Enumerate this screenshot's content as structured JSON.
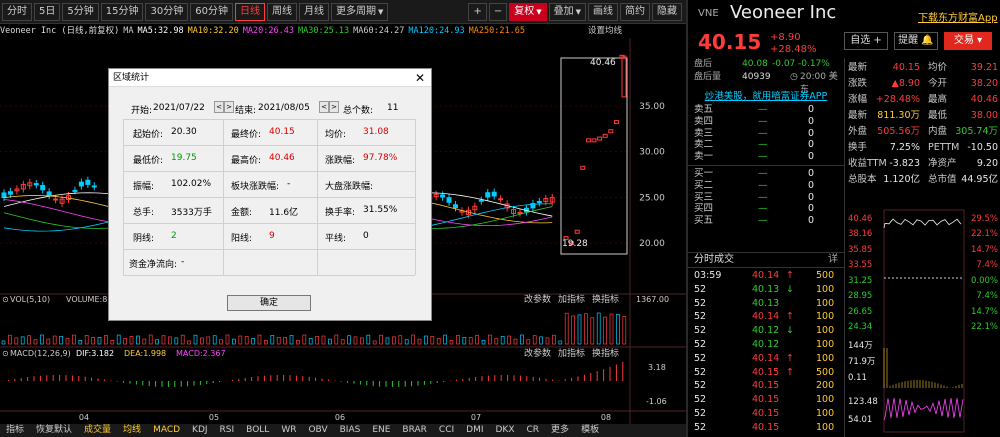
{
  "toolbar": {
    "periods": [
      "分时",
      "5日",
      "5分钟",
      "15分钟",
      "30分钟",
      "60分钟",
      "日线",
      "周线",
      "月线",
      "更多周期"
    ],
    "active": "日线",
    "right": [
      "复权",
      "叠加",
      "画线",
      "简约",
      "隐藏"
    ]
  },
  "ma_bar": {
    "name": "Veoneer Inc (日线,前复权)",
    "items": [
      {
        "k": "MA",
        "v": "",
        "c": "#cccccc"
      },
      {
        "k": "MA5:",
        "v": "32.98",
        "c": "#ffffff"
      },
      {
        "k": "MA10:",
        "v": "32.20",
        "c": "#ffcc33"
      },
      {
        "k": "MA20:",
        "v": "26.43",
        "c": "#ff44ff"
      },
      {
        "k": "MA30:",
        "v": "25.13",
        "c": "#2ccc2c"
      },
      {
        "k": "MA60:",
        "v": "24.27",
        "c": "#cccccc"
      },
      {
        "k": "MA120:",
        "v": "24.93",
        "c": "#00ccff"
      },
      {
        "k": "MA250:",
        "v": "21.65",
        "c": "#ff8800"
      }
    ],
    "settings": "设置均线"
  },
  "y_axis": [
    "35.00",
    "30.00",
    "25.00",
    "20.00"
  ],
  "price_labels": {
    "high": "40.46",
    "low": "19.28"
  },
  "vol": {
    "label": "VOL(5,10)",
    "value": "VOLUME:8112",
    "axis": "1367.00",
    "links": [
      "改参数",
      "加指标",
      "换指标"
    ]
  },
  "macd": {
    "label": "MACD(12,26,9)",
    "dif": "DIF:3.182",
    "dea": "DEA:1.998",
    "macd": "MACD:2.367",
    "axis_top": "3.18",
    "axis_bot": "-1.06",
    "links": [
      "改参数",
      "加指标",
      "换指标"
    ]
  },
  "x_axis": [
    "04",
    "05",
    "06",
    "07",
    "08"
  ],
  "bottom_tabs": [
    "指标",
    "恢复默认",
    "成交量",
    "均线",
    "MACD",
    "KDJ",
    "RSI",
    "BOLL",
    "WR",
    "OBV",
    "BIAS",
    "ENE",
    "BRAR",
    "CCI",
    "DMI",
    "DKX",
    "CR",
    "更多",
    "模板"
  ],
  "dialog": {
    "title": "区域统计",
    "start_label": "开始:",
    "start": "2021/07/22",
    "end_label": "结束:",
    "end": "2021/08/05",
    "total_label": "总个数:",
    "total": "11",
    "rows": [
      [
        {
          "l": "起始价:",
          "v": "20.30",
          "c": "#000"
        },
        {
          "l": "最终价:",
          "v": "40.15",
          "c": "#d00"
        },
        {
          "l": "均价:",
          "v": "31.08",
          "c": "#d00"
        }
      ],
      [
        {
          "l": "最低价:",
          "v": "19.75",
          "c": "#090"
        },
        {
          "l": "最高价:",
          "v": "40.46",
          "c": "#d00"
        },
        {
          "l": "涨跌幅:",
          "v": "97.78%",
          "c": "#d00"
        }
      ],
      [
        {
          "l": "振幅:",
          "v": "102.02%",
          "c": "#000"
        },
        {
          "l": "板块涨跌幅:",
          "v": "-",
          "c": "#000"
        },
        {
          "l": "大盘涨跌幅:",
          "v": "-",
          "c": "#000"
        }
      ],
      [
        {
          "l": "总手:",
          "v": "3533万手",
          "c": "#000"
        },
        {
          "l": "金额:",
          "v": "11.6亿",
          "c": "#000"
        },
        {
          "l": "换手率:",
          "v": "31.55%",
          "c": "#000"
        }
      ],
      [
        {
          "l": "阴线:",
          "v": "2",
          "c": "#090"
        },
        {
          "l": "阳线:",
          "v": "9",
          "c": "#d00"
        },
        {
          "l": "平线:",
          "v": "0",
          "c": "#000"
        }
      ]
    ],
    "flow_label": "资金净流向:",
    "flow": "-",
    "ok": "确定"
  },
  "right": {
    "exchange": "VNE",
    "name": "Veoneer Inc",
    "download": "下载东方财富App",
    "price": "40.15",
    "chg": "+8.90",
    "pct": "+28.48%",
    "btn_watch": "自选",
    "btn_alert": "提醒",
    "btn_trade": "交易",
    "after": {
      "l1": "盘后",
      "p": "40.08",
      "c": "-0.07",
      "pc": "-0.17%",
      "time": "20:00 美东",
      "l2": "盘后量",
      "vol": "40939"
    },
    "promo": "炒港美股，就用喑富证券APP",
    "asks": [
      {
        "l": "卖五",
        "p": "—",
        "v": "0"
      },
      {
        "l": "卖四",
        "p": "—",
        "v": "0"
      },
      {
        "l": "卖三",
        "p": "—",
        "v": "0"
      },
      {
        "l": "卖二",
        "p": "—",
        "v": "0"
      },
      {
        "l": "卖一",
        "p": "—",
        "v": "0"
      }
    ],
    "bids": [
      {
        "l": "买一",
        "p": "—",
        "v": "0"
      },
      {
        "l": "买二",
        "p": "—",
        "v": "0"
      },
      {
        "l": "买三",
        "p": "—",
        "v": "0"
      },
      {
        "l": "买四",
        "p": "—",
        "v": "0"
      },
      {
        "l": "买五",
        "p": "—",
        "v": "0"
      }
    ],
    "trades_title": "分时成交",
    "trades_more": "详",
    "trades": [
      {
        "t": "03:59",
        "p": "40.14",
        "a": "↑",
        "v": "500",
        "c": "#ff3c3c"
      },
      {
        "t": "52",
        "p": "40.13",
        "a": "↓",
        "v": "100",
        "c": "#2ccc2c"
      },
      {
        "t": "52",
        "p": "40.13",
        "a": "",
        "v": "100",
        "c": "#2ccc2c"
      },
      {
        "t": "52",
        "p": "40.14",
        "a": "↑",
        "v": "100",
        "c": "#ff3c3c"
      },
      {
        "t": "52",
        "p": "40.12",
        "a": "↓",
        "v": "100",
        "c": "#2ccc2c"
      },
      {
        "t": "52",
        "p": "40.12",
        "a": "",
        "v": "100",
        "c": "#2ccc2c"
      },
      {
        "t": "52",
        "p": "40.14",
        "a": "↑",
        "v": "100",
        "c": "#ff3c3c"
      },
      {
        "t": "52",
        "p": "40.15",
        "a": "↑",
        "v": "500",
        "c": "#ff3c3c"
      },
      {
        "t": "52",
        "p": "40.15",
        "a": "",
        "v": "200",
        "c": "#ff3c3c"
      },
      {
        "t": "52",
        "p": "40.15",
        "a": "",
        "v": "100",
        "c": "#ff3c3c"
      },
      {
        "t": "52",
        "p": "40.15",
        "a": "",
        "v": "100",
        "c": "#ff3c3c"
      },
      {
        "t": "52",
        "p": "40.15",
        "a": "",
        "v": "100",
        "c": "#ff3c3c"
      }
    ],
    "stats": [
      [
        {
          "l": "最新",
          "v": "40.15",
          "c": "#ff3c3c"
        },
        {
          "l": "均价",
          "v": "39.21",
          "c": "#ff3c3c"
        }
      ],
      [
        {
          "l": "涨跌",
          "v": "▲8.90",
          "c": "#ff3c3c"
        },
        {
          "l": "今开",
          "v": "38.20",
          "c": "#ff3c3c"
        }
      ],
      [
        {
          "l": "涨幅",
          "v": "+28.48%",
          "c": "#ff3c3c"
        },
        {
          "l": "最高",
          "v": "40.46",
          "c": "#ff3c3c"
        }
      ],
      [
        {
          "l": "最新",
          "v": "811.30万",
          "c": "#ffcc33"
        },
        {
          "l": "最低",
          "v": "38.00",
          "c": "#ff3c3c"
        }
      ],
      [
        {
          "l": "外盘",
          "v": "505.56万",
          "c": "#ff3c3c"
        },
        {
          "l": "内盘",
          "v": "305.74万",
          "c": "#2ccc2c"
        }
      ],
      [
        {
          "l": "换手",
          "v": "7.25%",
          "c": "#e8e8e8"
        },
        {
          "l": "PETTM",
          "v": "-10.50",
          "c": "#e8e8e8"
        }
      ],
      [
        {
          "l": "收益TTM",
          "v": "-3.823",
          "c": "#e8e8e8"
        },
        {
          "l": "净资产",
          "v": "9.20",
          "c": "#e8e8e8"
        }
      ],
      [
        {
          "l": "总股本",
          "v": "1.120亿",
          "c": "#e8e8e8"
        },
        {
          "l": "总市值",
          "v": "44.95亿",
          "c": "#e8e8e8"
        }
      ]
    ],
    "mini_left": [
      "40.46",
      "38.16",
      "35.85",
      "33.55",
      "31.25",
      "28.95",
      "26.65",
      "24.34",
      "144万",
      "71.9万",
      "0.11",
      "123.48",
      "54.01"
    ],
    "mini_right": [
      "29.5%",
      "22.1%",
      "14.7%",
      "7.4%",
      "0.00%",
      "7.4%",
      "14.7%",
      "22.1%"
    ]
  }
}
